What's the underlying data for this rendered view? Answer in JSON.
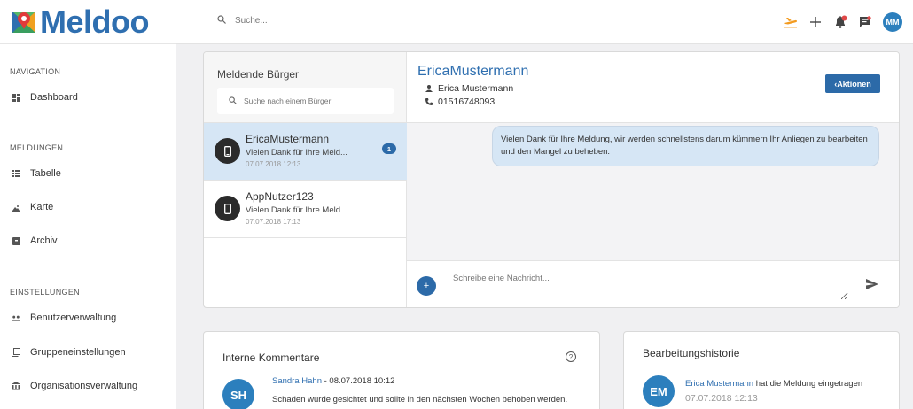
{
  "brand": {
    "name": "Meldoo",
    "color": "#2f6fb0"
  },
  "topbar": {
    "search_placeholder": "Suche...",
    "icons": [
      "airplane-icon",
      "plus-icon",
      "bell-icon",
      "feedback-icon"
    ],
    "user_initials": "MM"
  },
  "sidebar": {
    "sections": [
      {
        "title": "NAVIGATION",
        "items": [
          {
            "label": "Dashboard",
            "icon": "dashboard-icon"
          }
        ]
      },
      {
        "title": "MELDUNGEN",
        "items": [
          {
            "label": "Tabelle",
            "icon": "list-icon"
          },
          {
            "label": "Karte",
            "icon": "map-icon"
          },
          {
            "label": "Archiv",
            "icon": "archive-icon"
          }
        ]
      },
      {
        "title": "EINSTELLUNGEN",
        "items": [
          {
            "label": "Benutzerverwaltung",
            "icon": "users-icon"
          },
          {
            "label": "Gruppeneinstellungen",
            "icon": "groups-icon"
          },
          {
            "label": "Organisationsverwaltung",
            "icon": "bank-icon"
          }
        ]
      }
    ]
  },
  "citizens": {
    "title": "Meldende Bürger",
    "search_placeholder": "Suche nach einem Bürger",
    "items": [
      {
        "name": "EricaMustermann",
        "preview": "Vielen Dank für Ihre Meld...",
        "date": "07.07.2018 12:13",
        "unread": "1",
        "active": true
      },
      {
        "name": "AppNutzer123",
        "preview": "Vielen Dank für Ihre Meld...",
        "date": "07.07.2018 17:13",
        "unread": "",
        "active": false
      }
    ]
  },
  "conversation": {
    "username": "EricaMustermann",
    "full_name": "Erica Mustermann",
    "phone": "01516748093",
    "actions_label": "Aktionen",
    "messages": [
      {
        "text": "Vielen Dank für Ihre Meldung, wir werden schnellstens darum kümmern Ihr Anliegen zu bearbeiten und den Mangel zu beheben."
      }
    ],
    "compose_placeholder": "Schreibe eine Nachricht...",
    "add_label": "+"
  },
  "comments": {
    "title": "Interne Kommentare",
    "help": "?",
    "items": [
      {
        "initials": "SH",
        "author": "Sandra Hahn",
        "date": " - 08.07.2018 10:12",
        "text": "Schaden wurde gesichtet und sollte in den nächsten Wochen behoben werden."
      }
    ]
  },
  "history": {
    "title": "Bearbeitungshistorie",
    "items": [
      {
        "initials": "EM",
        "actor": "Erica Mustermann",
        "action": " hat die Meldung eingetragen",
        "date": "07.07.2018 12:13"
      }
    ]
  },
  "colors": {
    "accent": "#2c6aa8",
    "avatar": "#2c7fbd",
    "orange": "#f39a1e",
    "bell_dot": "#e04848"
  }
}
